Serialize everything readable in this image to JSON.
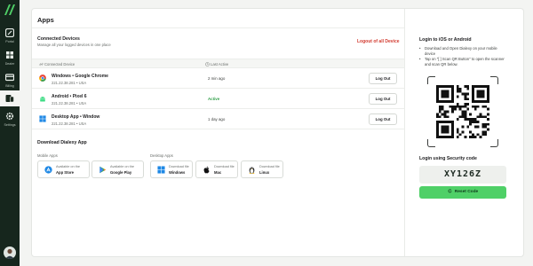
{
  "sidebar": {
    "items": [
      {
        "label": "Portal",
        "icon": "portal-icon"
      },
      {
        "label": "Dealer",
        "icon": "dealer-icon"
      },
      {
        "label": "Billing",
        "icon": "billing-icon"
      },
      {
        "label": "",
        "icon": "devices-icon",
        "active": true
      },
      {
        "label": "Settings",
        "icon": "gear-icon"
      }
    ]
  },
  "main": {
    "title": "Apps",
    "connected": {
      "heading": "Connected Devices",
      "subheading": "Manage all your logged devices in one place",
      "logout_all": "Logout of all Device",
      "columns": [
        "Connected Device",
        "Last Active"
      ],
      "rows": [
        {
          "os": "chrome",
          "device": "Windows • Google Chrome",
          "ip": "221.22.38.281 • USA",
          "last_active": "2 min ago",
          "active": false,
          "button": "Log Out"
        },
        {
          "os": "android",
          "device": "Android • Pixel 6",
          "ip": "221.22.38.281 • USA",
          "last_active": "Active",
          "active": true,
          "button": "Log Out"
        },
        {
          "os": "windows",
          "device": "Desktop App • Window",
          "ip": "221.22.38.281 • USA",
          "last_active": "1 day ago",
          "active": false,
          "button": "Log Out"
        }
      ]
    },
    "download": {
      "heading": "Download Dialexy App",
      "mobile_label": "Mobile Apps",
      "desktop_label": "Desktop Apps",
      "mobile": [
        {
          "line1": "Available on the",
          "line2": "App Store",
          "icon": "app-store-icon"
        },
        {
          "line1": "Available on the",
          "line2": "Google Play",
          "icon": "google-play-icon"
        }
      ],
      "desktop": [
        {
          "line1": "Download file",
          "line2": "Windows",
          "icon": "windows-icon"
        },
        {
          "line1": "Download file",
          "line2": "Mac",
          "icon": "apple-icon"
        },
        {
          "line1": "Download file",
          "line2": "Linux",
          "icon": "linux-icon"
        }
      ]
    }
  },
  "right": {
    "heading": "Login to iOS or Android",
    "bullets": [
      "Download and Open Dialexy on your mobile device",
      "Tap on \"[ ] Scan QR Button\" to open the scanner and scan QR below."
    ],
    "security_heading": "Login using Security code",
    "code": "XY126Z",
    "reset_label": "Reset Code"
  },
  "colors": {
    "sidebar": "#16261d",
    "accent_green": "#4fd067",
    "danger": "#d23a2f",
    "active_text": "#2f9f48"
  }
}
